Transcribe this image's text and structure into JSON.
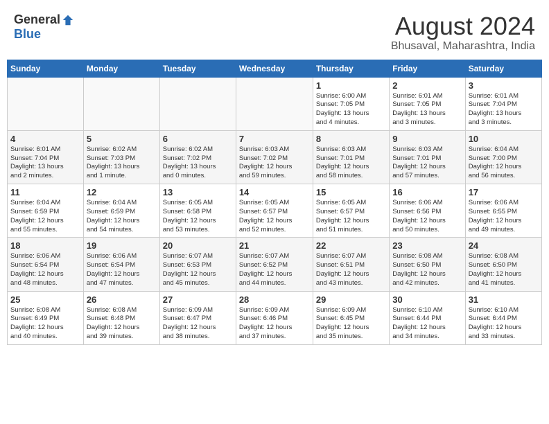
{
  "header": {
    "logo_general": "General",
    "logo_blue": "Blue",
    "month_title": "August 2024",
    "location": "Bhusaval, Maharashtra, India"
  },
  "calendar": {
    "days_of_week": [
      "Sunday",
      "Monday",
      "Tuesday",
      "Wednesday",
      "Thursday",
      "Friday",
      "Saturday"
    ],
    "weeks": [
      [
        {
          "day": "",
          "info": ""
        },
        {
          "day": "",
          "info": ""
        },
        {
          "day": "",
          "info": ""
        },
        {
          "day": "",
          "info": ""
        },
        {
          "day": "1",
          "info": "Sunrise: 6:00 AM\nSunset: 7:05 PM\nDaylight: 13 hours\nand 4 minutes."
        },
        {
          "day": "2",
          "info": "Sunrise: 6:01 AM\nSunset: 7:05 PM\nDaylight: 13 hours\nand 3 minutes."
        },
        {
          "day": "3",
          "info": "Sunrise: 6:01 AM\nSunset: 7:04 PM\nDaylight: 13 hours\nand 3 minutes."
        }
      ],
      [
        {
          "day": "4",
          "info": "Sunrise: 6:01 AM\nSunset: 7:04 PM\nDaylight: 13 hours\nand 2 minutes."
        },
        {
          "day": "5",
          "info": "Sunrise: 6:02 AM\nSunset: 7:03 PM\nDaylight: 13 hours\nand 1 minute."
        },
        {
          "day": "6",
          "info": "Sunrise: 6:02 AM\nSunset: 7:02 PM\nDaylight: 13 hours\nand 0 minutes."
        },
        {
          "day": "7",
          "info": "Sunrise: 6:03 AM\nSunset: 7:02 PM\nDaylight: 12 hours\nand 59 minutes."
        },
        {
          "day": "8",
          "info": "Sunrise: 6:03 AM\nSunset: 7:01 PM\nDaylight: 12 hours\nand 58 minutes."
        },
        {
          "day": "9",
          "info": "Sunrise: 6:03 AM\nSunset: 7:01 PM\nDaylight: 12 hours\nand 57 minutes."
        },
        {
          "day": "10",
          "info": "Sunrise: 6:04 AM\nSunset: 7:00 PM\nDaylight: 12 hours\nand 56 minutes."
        }
      ],
      [
        {
          "day": "11",
          "info": "Sunrise: 6:04 AM\nSunset: 6:59 PM\nDaylight: 12 hours\nand 55 minutes."
        },
        {
          "day": "12",
          "info": "Sunrise: 6:04 AM\nSunset: 6:59 PM\nDaylight: 12 hours\nand 54 minutes."
        },
        {
          "day": "13",
          "info": "Sunrise: 6:05 AM\nSunset: 6:58 PM\nDaylight: 12 hours\nand 53 minutes."
        },
        {
          "day": "14",
          "info": "Sunrise: 6:05 AM\nSunset: 6:57 PM\nDaylight: 12 hours\nand 52 minutes."
        },
        {
          "day": "15",
          "info": "Sunrise: 6:05 AM\nSunset: 6:57 PM\nDaylight: 12 hours\nand 51 minutes."
        },
        {
          "day": "16",
          "info": "Sunrise: 6:06 AM\nSunset: 6:56 PM\nDaylight: 12 hours\nand 50 minutes."
        },
        {
          "day": "17",
          "info": "Sunrise: 6:06 AM\nSunset: 6:55 PM\nDaylight: 12 hours\nand 49 minutes."
        }
      ],
      [
        {
          "day": "18",
          "info": "Sunrise: 6:06 AM\nSunset: 6:54 PM\nDaylight: 12 hours\nand 48 minutes."
        },
        {
          "day": "19",
          "info": "Sunrise: 6:06 AM\nSunset: 6:54 PM\nDaylight: 12 hours\nand 47 minutes."
        },
        {
          "day": "20",
          "info": "Sunrise: 6:07 AM\nSunset: 6:53 PM\nDaylight: 12 hours\nand 45 minutes."
        },
        {
          "day": "21",
          "info": "Sunrise: 6:07 AM\nSunset: 6:52 PM\nDaylight: 12 hours\nand 44 minutes."
        },
        {
          "day": "22",
          "info": "Sunrise: 6:07 AM\nSunset: 6:51 PM\nDaylight: 12 hours\nand 43 minutes."
        },
        {
          "day": "23",
          "info": "Sunrise: 6:08 AM\nSunset: 6:50 PM\nDaylight: 12 hours\nand 42 minutes."
        },
        {
          "day": "24",
          "info": "Sunrise: 6:08 AM\nSunset: 6:50 PM\nDaylight: 12 hours\nand 41 minutes."
        }
      ],
      [
        {
          "day": "25",
          "info": "Sunrise: 6:08 AM\nSunset: 6:49 PM\nDaylight: 12 hours\nand 40 minutes."
        },
        {
          "day": "26",
          "info": "Sunrise: 6:08 AM\nSunset: 6:48 PM\nDaylight: 12 hours\nand 39 minutes."
        },
        {
          "day": "27",
          "info": "Sunrise: 6:09 AM\nSunset: 6:47 PM\nDaylight: 12 hours\nand 38 minutes."
        },
        {
          "day": "28",
          "info": "Sunrise: 6:09 AM\nSunset: 6:46 PM\nDaylight: 12 hours\nand 37 minutes."
        },
        {
          "day": "29",
          "info": "Sunrise: 6:09 AM\nSunset: 6:45 PM\nDaylight: 12 hours\nand 35 minutes."
        },
        {
          "day": "30",
          "info": "Sunrise: 6:10 AM\nSunset: 6:44 PM\nDaylight: 12 hours\nand 34 minutes."
        },
        {
          "day": "31",
          "info": "Sunrise: 6:10 AM\nSunset: 6:44 PM\nDaylight: 12 hours\nand 33 minutes."
        }
      ]
    ]
  }
}
